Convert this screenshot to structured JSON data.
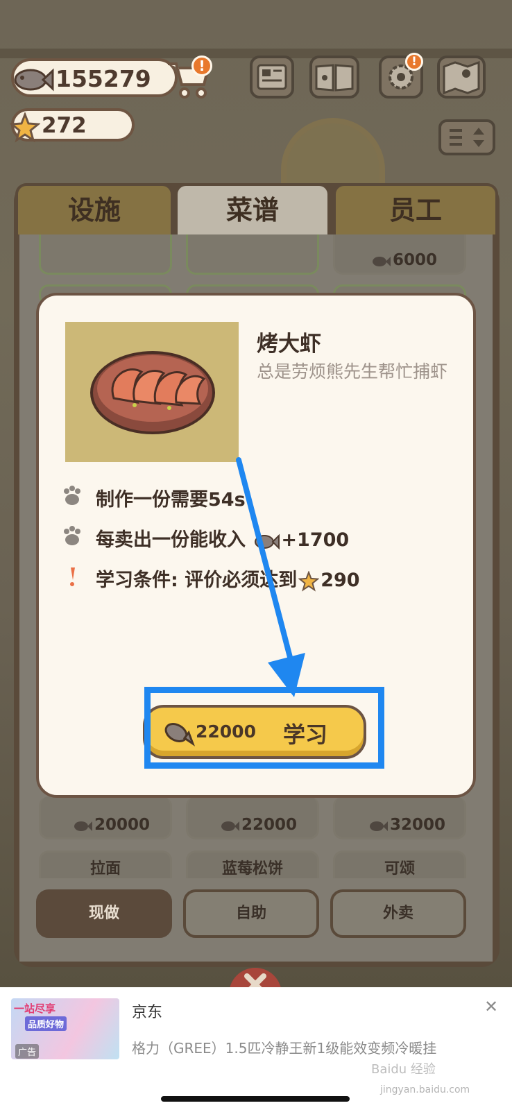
{
  "hud": {
    "coins": "155279",
    "stars": "272",
    "cart_alert": "!",
    "settings_alert": "!"
  },
  "tabs": [
    {
      "label": "设施",
      "active": false
    },
    {
      "label": "菜谱",
      "active": true
    },
    {
      "label": "员工",
      "active": false
    }
  ],
  "recipe_list": {
    "top_price": "6000",
    "row_prices": [
      "20000",
      "22000",
      "32000"
    ],
    "row_names": [
      "拉面",
      "蓝莓松饼",
      "可颂"
    ]
  },
  "modes": [
    {
      "label": "现做",
      "active": true
    },
    {
      "label": "自助",
      "active": false
    },
    {
      "label": "外卖",
      "active": false
    }
  ],
  "modal": {
    "dish_name": "烤大虾",
    "description": "总是劳烦熊先生帮忙捕虾",
    "make_time": "制作一份需要54s",
    "income_label": "每卖出一份能收入",
    "income_value": "+1700",
    "condition_label": "学习条件: 评价必须达到",
    "condition_value": "290",
    "learn_cost": "22000",
    "learn_label": "学习"
  },
  "ad": {
    "thumb_line1": "一站尽享",
    "thumb_line2": "品质好物",
    "ad_tag": "广告",
    "title": "京东",
    "description": "格力（GREE）1.5匹冷静王新1级能效变频冷暖挂",
    "close": "✕"
  },
  "watermark": {
    "brand": "Baidu 经验",
    "url": "jingyan.baidu.com"
  },
  "colors": {
    "accent_blue": "#1f87f0",
    "button_yellow": "#f5c94b",
    "panel_brown": "#6c5444"
  }
}
